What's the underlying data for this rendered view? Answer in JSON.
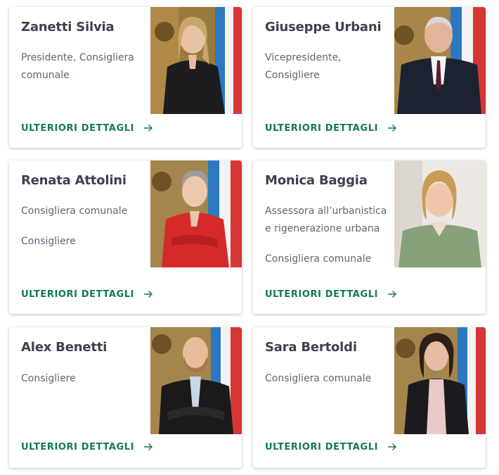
{
  "link_label": "ULTERIORI DETTAGLI",
  "people": [
    {
      "name": "Zanetti Silvia",
      "roles": [
        "Presidente, Consigliera comunale"
      ]
    },
    {
      "name": "Giuseppe Urbani",
      "roles": [
        "Vicepresidente, Consigliere"
      ]
    },
    {
      "name": "Renata Attolini",
      "roles": [
        "Consigliera comunale",
        "Consigliere"
      ]
    },
    {
      "name": "Monica Baggia",
      "roles": [
        "Assessora all’urbanistica e rigenerazione urbana",
        "Consigliera comunale"
      ]
    },
    {
      "name": "Alex Benetti",
      "roles": [
        "Consigliere"
      ]
    },
    {
      "name": "Sara Bertoldi",
      "roles": [
        "Consigliera comunale"
      ]
    }
  ],
  "colors": {
    "link": "#137a4d",
    "title": "#3a4250",
    "text": "#5c6775"
  }
}
